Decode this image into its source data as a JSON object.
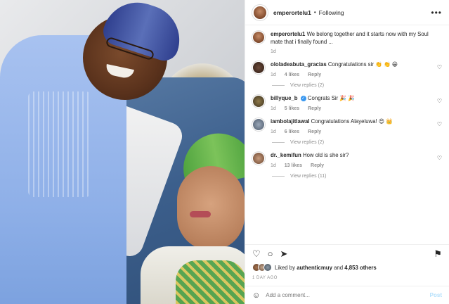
{
  "header": {
    "username": "emperortelu1",
    "separator": "•",
    "follow_label": "Following",
    "more_label": "•••"
  },
  "caption": {
    "username": "emperortelu1",
    "text": "We belong together and it starts now with my Soul mate that i finally found ...",
    "age": "1d"
  },
  "comments": [
    {
      "username": "ololadeabuta_gracias",
      "text": "Congratulations sir 👏 👏 😁",
      "age": "1d",
      "likes": "4 likes",
      "reply_label": "Reply",
      "view_replies": "View replies (2)",
      "verified": false
    },
    {
      "username": "billyque_b",
      "text": "Congrats Sir 🎉 🎉",
      "age": "1d",
      "likes": "5 likes",
      "reply_label": "Reply",
      "view_replies": "",
      "verified": true
    },
    {
      "username": "iambolajitlawal",
      "text": "Congratulations Alayeluwa! 😍 👑",
      "age": "1d",
      "likes": "6 likes",
      "reply_label": "Reply",
      "view_replies": "View replies (2)",
      "verified": false
    },
    {
      "username": "dr._kemifun",
      "text": "How old is she sir?",
      "age": "1d",
      "likes": "13 likes",
      "reply_label": "Reply",
      "view_replies": "View replies (11)",
      "verified": false
    }
  ],
  "actions": {
    "like_icon": "heart-outline-icon",
    "comment_icon": "comment-icon",
    "share_icon": "share-icon",
    "save_icon": "bookmark-icon"
  },
  "likes": {
    "prefix": "Liked by",
    "user": "authenticmuy",
    "suffix": "and",
    "others": "4,853 others"
  },
  "time_ago": "1 DAY AGO",
  "add_comment": {
    "placeholder": "Add a comment...",
    "post_label": "Post"
  },
  "colors": {
    "verified": "#3897f0",
    "post_disabled": "#b2dffc",
    "muted": "#8e8e8e"
  }
}
